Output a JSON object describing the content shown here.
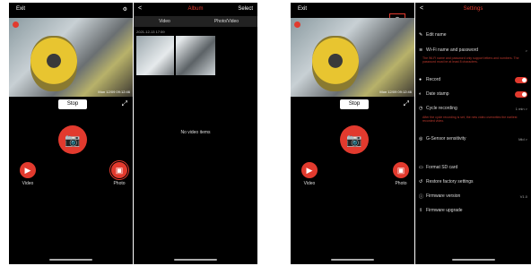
{
  "screen1": {
    "left_label": "Exit",
    "stop_label": "Stop",
    "timestamp": "Mon 12/09 09:12:46",
    "left_button_label": "Video",
    "right_button_label": "Photo"
  },
  "screen2": {
    "back": "<",
    "title": "Album",
    "right": "Select",
    "tabs": [
      "Video",
      "Photo/Video"
    ],
    "date": "2021-12-13 17:59",
    "empty_text": "No video items"
  },
  "screen3": {
    "left_label": "Exit",
    "stop_label": "Stop",
    "timestamp": "Mon 12/09 09:12:46",
    "left_button_label": "Video",
    "right_button_label": "Photo"
  },
  "settings": {
    "back": "<",
    "title": "Settings",
    "rows": [
      {
        "icon": "✎",
        "label": "Edit name",
        "value": ""
      },
      {
        "icon": "≋",
        "label": "Wi-Fi name and password",
        "value": ">"
      },
      {
        "icon": "●",
        "label": "Record",
        "value": ""
      },
      {
        "icon": "◐",
        "label": "Date stamp",
        "value": ""
      },
      {
        "icon": "◷",
        "label": "Cycle recording",
        "value": "1 min >"
      },
      {
        "icon": "◎",
        "label": "G-Sensor sensitivity",
        "value": "Mid >"
      },
      {
        "icon": "▭",
        "label": "Format SD card",
        "value": ""
      },
      {
        "icon": "↺",
        "label": "Restore factory settings",
        "value": ""
      },
      {
        "icon": "ⓘ",
        "label": "Firmware version",
        "value": "V1.0"
      },
      {
        "icon": "⇪",
        "label": "Firmware upgrade",
        "value": ""
      }
    ],
    "notes": [
      "The Wi-Fi name and password only support letters and numbers. The password must be at least 8 characters.",
      "After the cycle recording is set, the new video overwrites the earliest recorded video."
    ]
  }
}
